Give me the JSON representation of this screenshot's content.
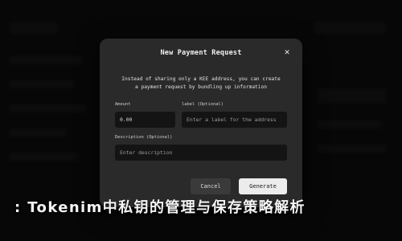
{
  "modal": {
    "title": "New Payment Request",
    "close_icon": "close-icon",
    "description_line1": "Instead of sharing only a KEE address, you can create",
    "description_line2": "a payment request by bundling up information",
    "amount": {
      "label": "Amount",
      "value": "0.00"
    },
    "label_field": {
      "label": "label (Optional)",
      "placeholder": "Enter a label for the address"
    },
    "description_field": {
      "label": "Description (Optional)",
      "placeholder": "Enter description"
    },
    "cancel_label": "Cancel",
    "generate_label": "Generate"
  },
  "headline": ": Tokenim中私钥的管理与保存策略解析",
  "colors": {
    "modal_bg": "#2a2a2a",
    "field_bg": "#141414",
    "primary_button": "#ececec",
    "secondary_button": "#3a3a3a"
  }
}
